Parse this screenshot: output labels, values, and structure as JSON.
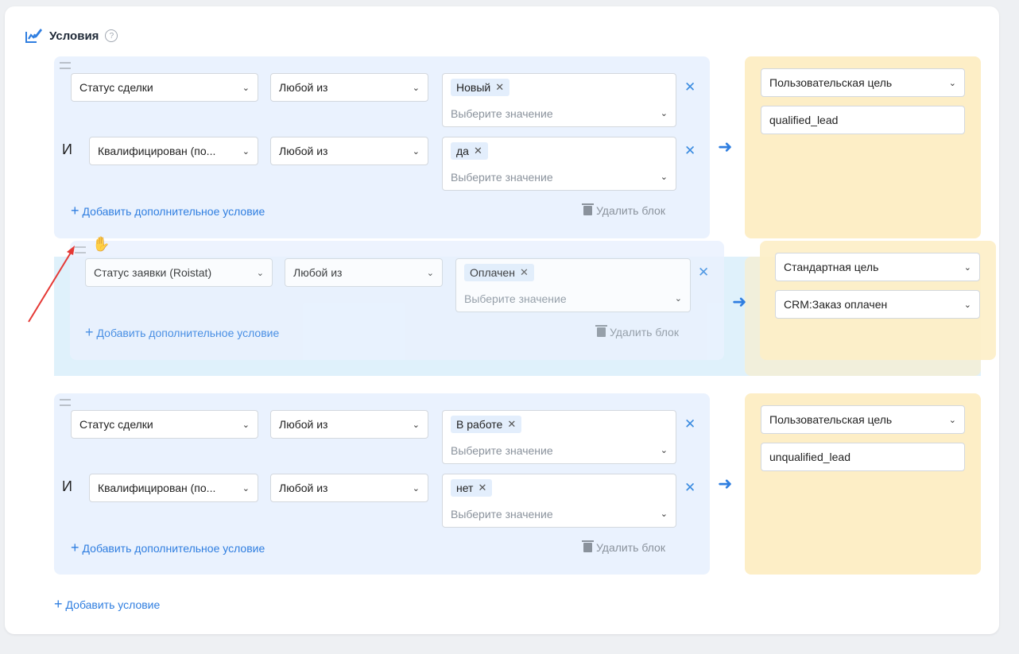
{
  "section": {
    "title": "Условия",
    "help": "?"
  },
  "connector": "И",
  "add_extra_condition": "Добавить дополнительное условие",
  "delete_block": "Удалить блок",
  "placeholder_value": "Выберите значение",
  "add_condition": "Добавить условие",
  "blocks": [
    {
      "rows": [
        {
          "field": "Статус сделки",
          "operator": "Любой из",
          "chips": [
            "Новый"
          ]
        },
        {
          "field": "Квалифицирован (по...",
          "operator": "Любой из",
          "chips": [
            "да"
          ]
        }
      ],
      "goal": {
        "type": "Пользовательская цель",
        "value": "qualified_lead"
      }
    },
    {
      "rows": [
        {
          "field": "Статус заявки (Roistat)",
          "operator": "Любой из",
          "chips": [
            "Оплачен"
          ]
        }
      ],
      "goal": {
        "type": "Стандартная цель",
        "value": "CRM:Заказ оплачен"
      }
    },
    {
      "rows": [
        {
          "field": "Статус сделки",
          "operator": "Любой из",
          "chips": [
            "В работе"
          ]
        },
        {
          "field": "Квалифицирован (по...",
          "operator": "Любой из",
          "chips": [
            "нет"
          ]
        }
      ],
      "goal": {
        "type": "Пользовательская цель",
        "value": "unqualified_lead"
      }
    }
  ],
  "colors": {
    "accent": "#2f7ee0",
    "block_bg": "#eaf2fe",
    "goal_bg": "#fdeec6",
    "annotation_arrow": "#e53935"
  },
  "icons": [
    "edit-chart-icon",
    "help-icon",
    "drag-handle-icon",
    "close-icon",
    "chevron-down-icon",
    "arrow-right-icon",
    "trash-icon",
    "plus-icon",
    "grab-hand-icon",
    "annotation-arrow"
  ]
}
